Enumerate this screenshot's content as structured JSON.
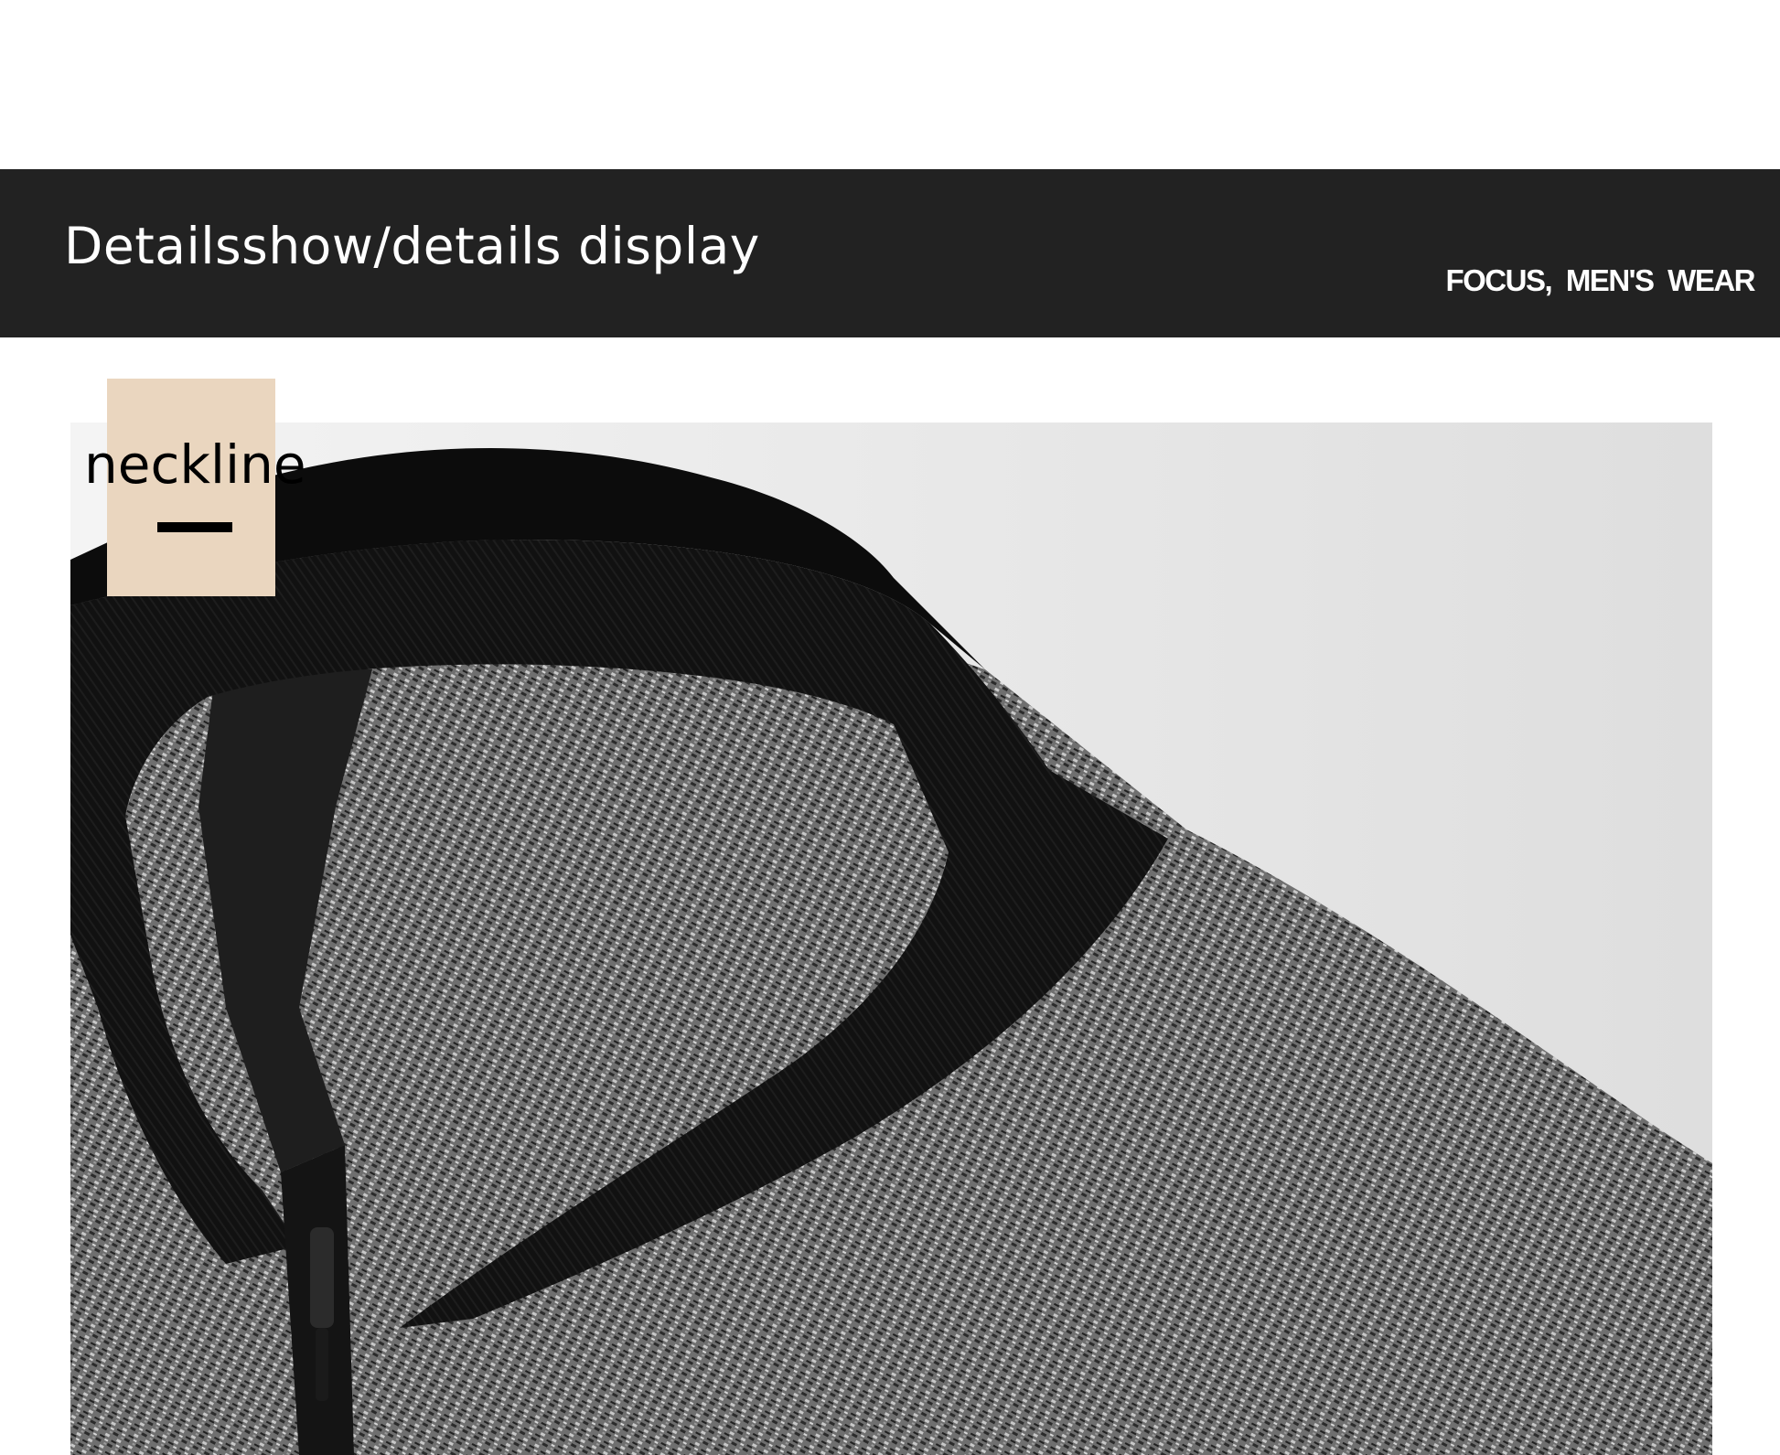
{
  "banner": {
    "title": "Detailsshow/details display",
    "tagline": "FOCUS,  MEN'S WEAR",
    "background_color": "#222222",
    "text_color": "#ffffff"
  },
  "label": {
    "text": "neckline",
    "box_color": "#ead6bf"
  },
  "photo": {
    "subject": "close-up of a grey heathered knit jacket with black ribbed collar and zipper"
  }
}
